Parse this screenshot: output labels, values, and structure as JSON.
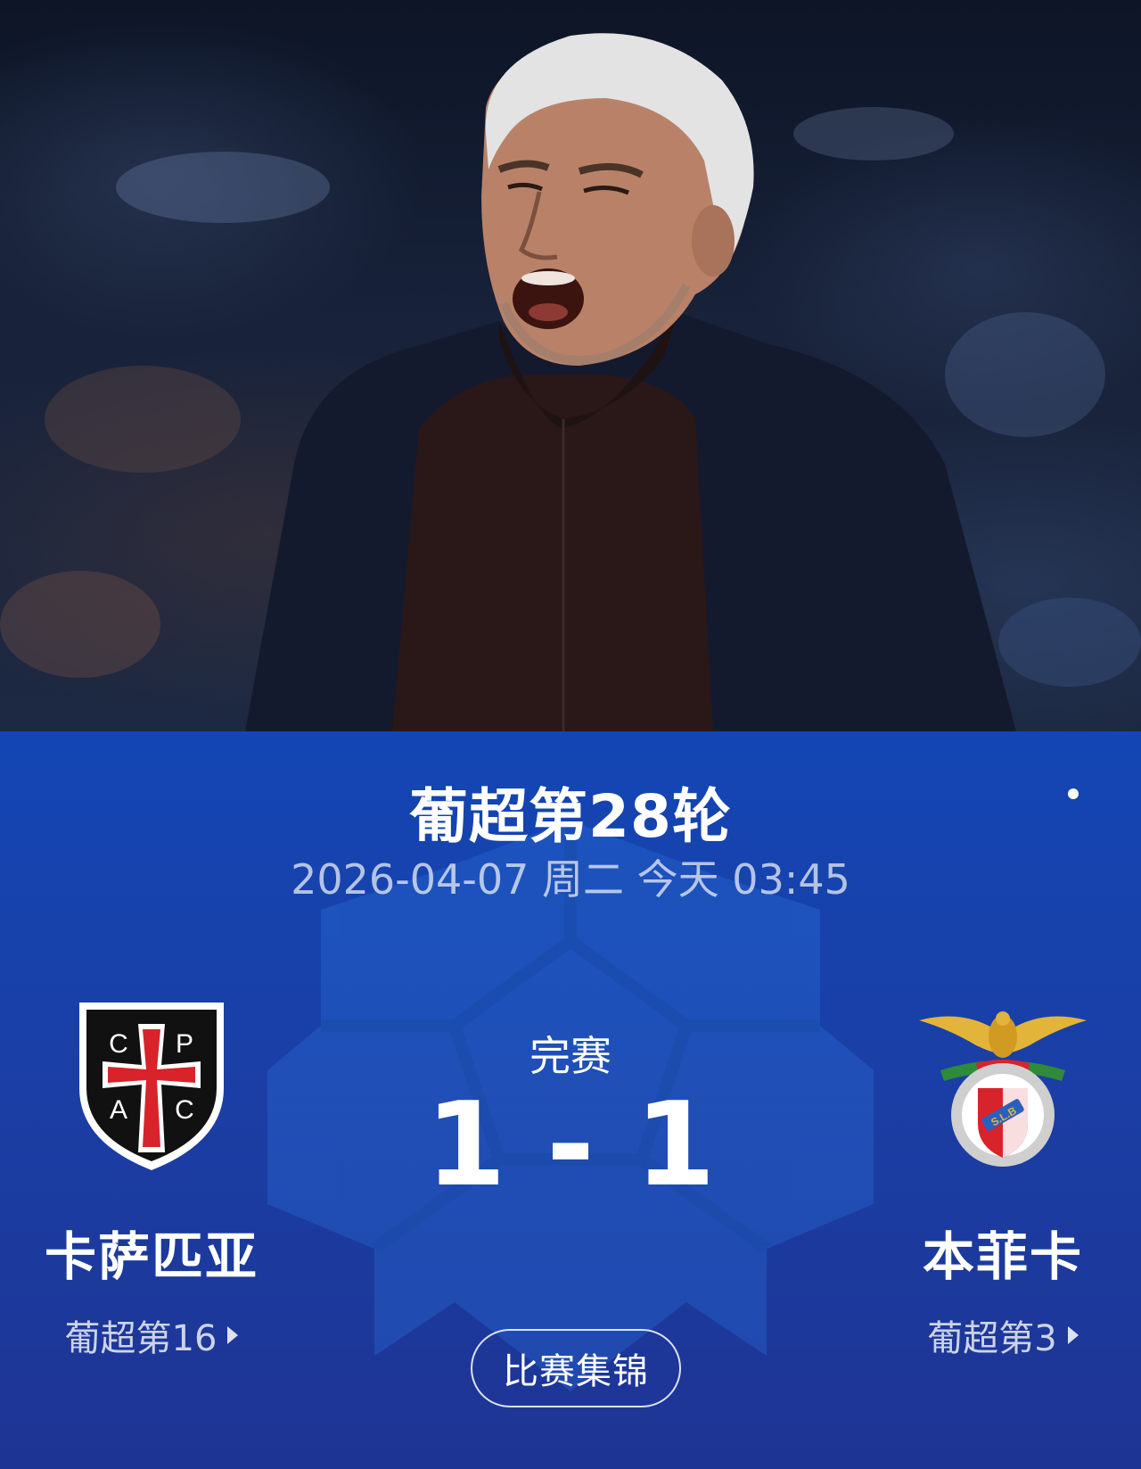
{
  "match": {
    "round": "葡超第28轮",
    "datetime": "2026-04-07 周二 今天 03:45",
    "status": "完赛",
    "score": "1 - 1",
    "highlights_label": "比赛集锦"
  },
  "home_team": {
    "name": "卡萨匹亚",
    "rank": "葡超第16",
    "crest_letters": [
      "C",
      "P",
      "A",
      "C"
    ],
    "colors": {
      "crest_bg": "#111111",
      "cross": "#d8232a",
      "border": "#ffffff"
    }
  },
  "away_team": {
    "name": "本菲卡",
    "rank": "葡超第3",
    "crest_text": "S.L.B",
    "colors": {
      "eagle": "#e2b43a",
      "shield": "#d8232a",
      "ring": "#b8b8b8"
    }
  },
  "colors": {
    "panel_top": "#1346b4",
    "panel_bottom": "#1e3494"
  },
  "hero": {
    "icon": "coach-photo"
  }
}
